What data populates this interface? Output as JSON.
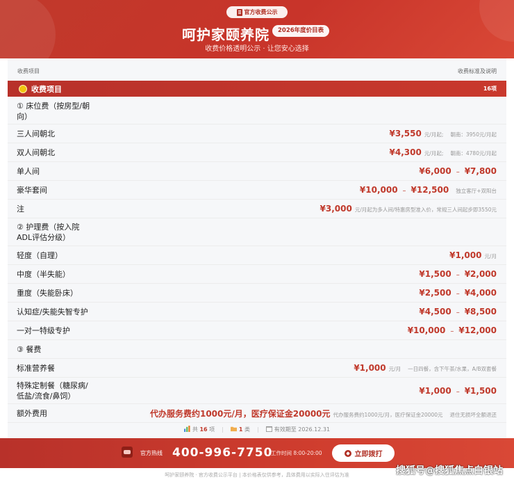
{
  "header": {
    "badge": "官方收费公示",
    "title": "呵护家颐养院",
    "year_badge": "2026年度价目表",
    "subtitle": "收费价格透明公示 · 让您安心选择"
  },
  "columns": {
    "left": "收费项目",
    "right": "收费标准及说明"
  },
  "section": {
    "title": "收费项目",
    "count": "16项"
  },
  "rows": [
    {
      "name": "① 床位费（按房型/朝\n向）"
    },
    {
      "name": "三人间朝北",
      "price": "¥3,550",
      "unit": "元/月起;",
      "note": "朝南：3950元/月起"
    },
    {
      "name": "双人间朝北",
      "price": "¥4,300",
      "unit": "元/月起;",
      "note": "朝南：4780元/月起"
    },
    {
      "name": "单人间",
      "price": "¥6,000",
      "price2": "¥7,800"
    },
    {
      "name": "豪华套间",
      "price": "¥10,000",
      "price2": "¥12,500",
      "note": "独立客厅+双阳台"
    },
    {
      "name": "注",
      "price": "¥3,000",
      "unit": "元/月起为多人间/特惠房型准入价，常规三人间起步即3550元"
    },
    {
      "name": "② 护理费（按入院\nADL评估分级）"
    },
    {
      "name": "轻度（自理）",
      "price": "¥1,000",
      "unit": "元/月"
    },
    {
      "name": "中度（半失能）",
      "price": "¥1,500",
      "price2": "¥2,000"
    },
    {
      "name": "重度（失能卧床）",
      "price": "¥2,500",
      "price2": "¥4,000"
    },
    {
      "name": "认知症/失能失智专护",
      "price": "¥4,500",
      "price2": "¥8,500"
    },
    {
      "name": "一对一特级专护",
      "price": "¥10,000",
      "price2": "¥12,000"
    },
    {
      "name": "③ 餐费"
    },
    {
      "name": "标准营养餐",
      "price": "¥1,000",
      "unit": "元/月",
      "note": "一日四餐，含下午茶/水果，A/B双套餐"
    },
    {
      "name": "特殊定制餐（糖尿病/\n低盐/流食/鼻饲）",
      "price": "¥1,000",
      "price2": "¥1,500"
    },
    {
      "name": "额外费用",
      "price": "代办服务费约1000元/月，医疗保证金20000元",
      "unit": "代办服务费约1000元/月，医疗保证金20000元",
      "note": "退住无损坏全额退还"
    }
  ],
  "stats": {
    "total_prefix": "共",
    "total": "16",
    "total_suffix": "项",
    "cat": "1",
    "cat_suffix": "类",
    "valid": "有效期至 2026.12.31"
  },
  "footer": {
    "hotline_label": "官方热线",
    "hotline": "400-996-7750",
    "hours": "工作时间 8:00-20:00",
    "call_button": "立即拨打"
  },
  "bottom_text": "呵护家颐养院 · 官方收费公示平台  |  本价格表仅供参考，具体费用以实际入住评估为准",
  "watermark": "搜狐号@搜狐焦点白银站"
}
